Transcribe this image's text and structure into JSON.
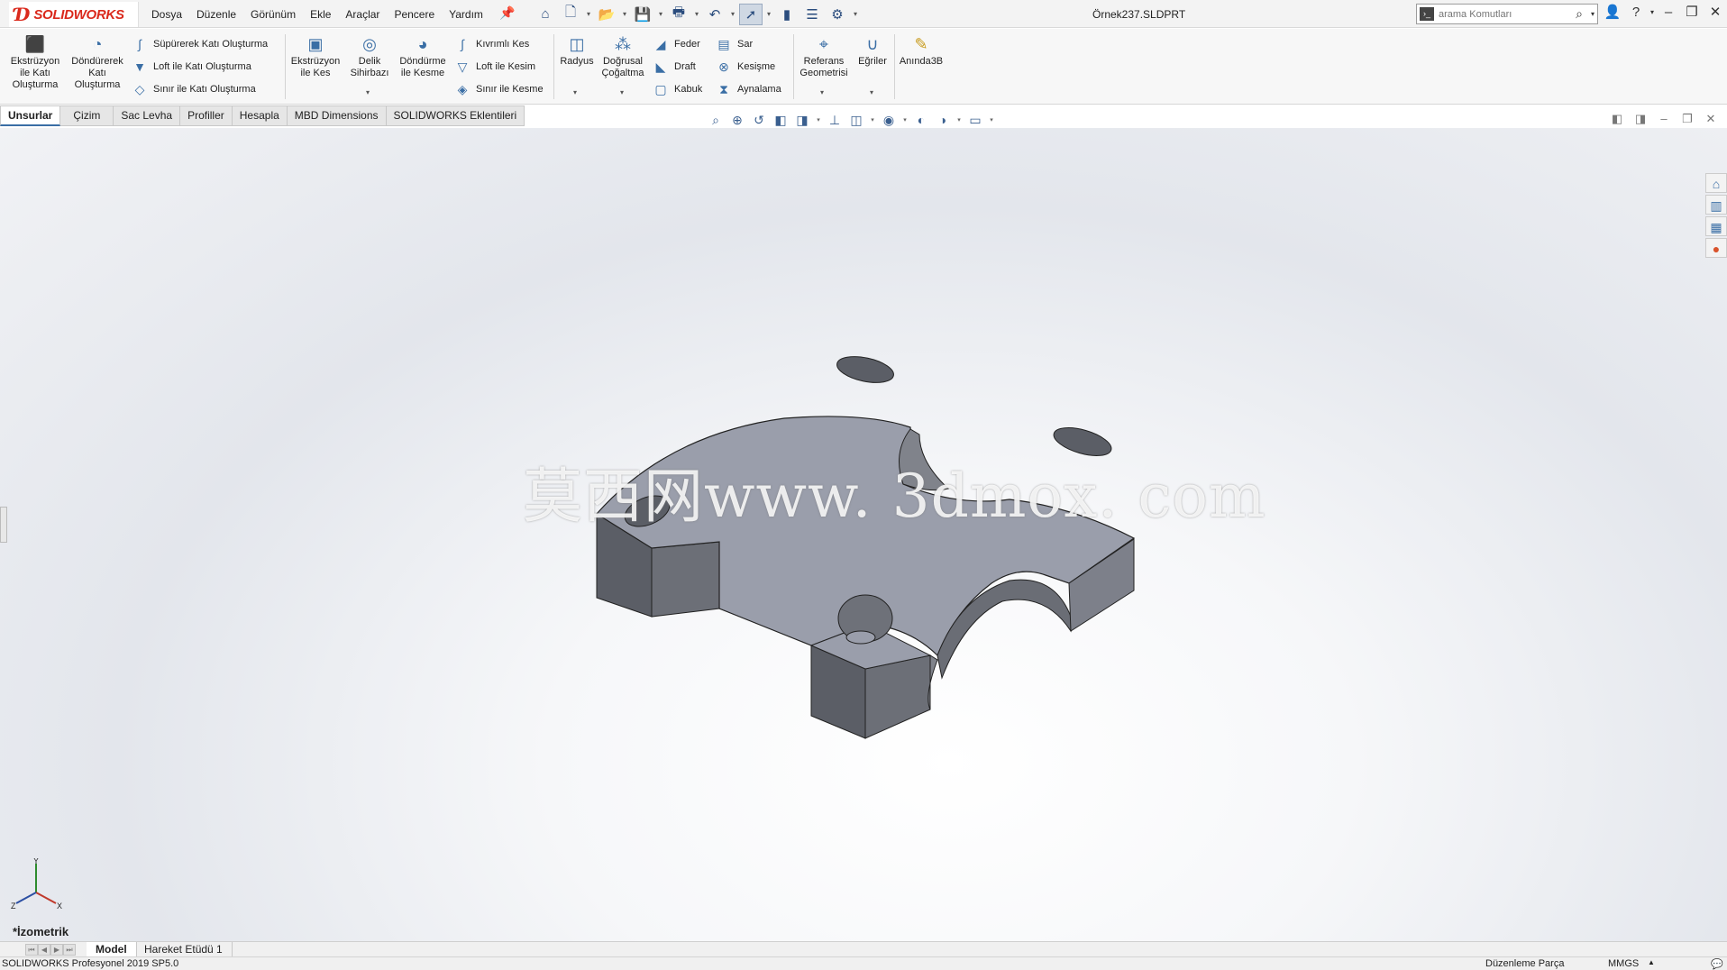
{
  "app": {
    "logo_text": "SOLIDWORKS",
    "document_title": "Örnek237.SLDPRT"
  },
  "menu": [
    "Dosya",
    "Düzenle",
    "Görünüm",
    "Ekle",
    "Araçlar",
    "Pencere",
    "Yardım"
  ],
  "search": {
    "placeholder": "arama Komutları"
  },
  "ribbon": {
    "extrude_boss": "Ekstrüzyon ile Katı Oluşturma",
    "revolve_boss": "Döndürerek Katı Oluşturma",
    "swept_boss": "Süpürerek Katı Oluşturma",
    "loft_boss": "Loft ile Katı Oluşturma",
    "boundary_boss": "Sınır ile Katı Oluşturma",
    "extrude_cut": "Ekstrüzyon ile Kes",
    "hole_wizard": "Delik Sihirbazı",
    "revolve_cut": "Döndürme ile Kesme",
    "swept_cut": "Kıvrımlı Kes",
    "loft_cut": "Loft ile Kesim",
    "boundary_cut": "Sınır ile Kesme",
    "fillet": "Radyus",
    "linear_pattern": "Doğrusal Çoğaltma",
    "rib": "Feder",
    "draft": "Draft",
    "shell": "Kabuk",
    "wrap": "Sar",
    "intersect": "Kesişme",
    "mirror": "Aynalama",
    "ref_geometry": "Referans Geometrisi",
    "curves": "Eğriler",
    "instant3d": "Anında3B"
  },
  "tabs": [
    "Unsurlar",
    "Çizim",
    "Sac Levha",
    "Profiller",
    "Hesapla",
    "MBD Dimensions",
    "SOLIDWORKS Eklentileri"
  ],
  "viewport": {
    "watermark": "莫西网www. 3dmox. com",
    "view_name": "*İzometrik",
    "triad": {
      "x": "X",
      "y": "Y",
      "z": "Z"
    }
  },
  "bottom_tabs": [
    "Model",
    "Hareket Etüdü 1"
  ],
  "status": {
    "version": "SOLIDWORKS Profesyonel 2019 SP5.0",
    "mode": "Düzenleme Parça",
    "units": "MMGS"
  }
}
